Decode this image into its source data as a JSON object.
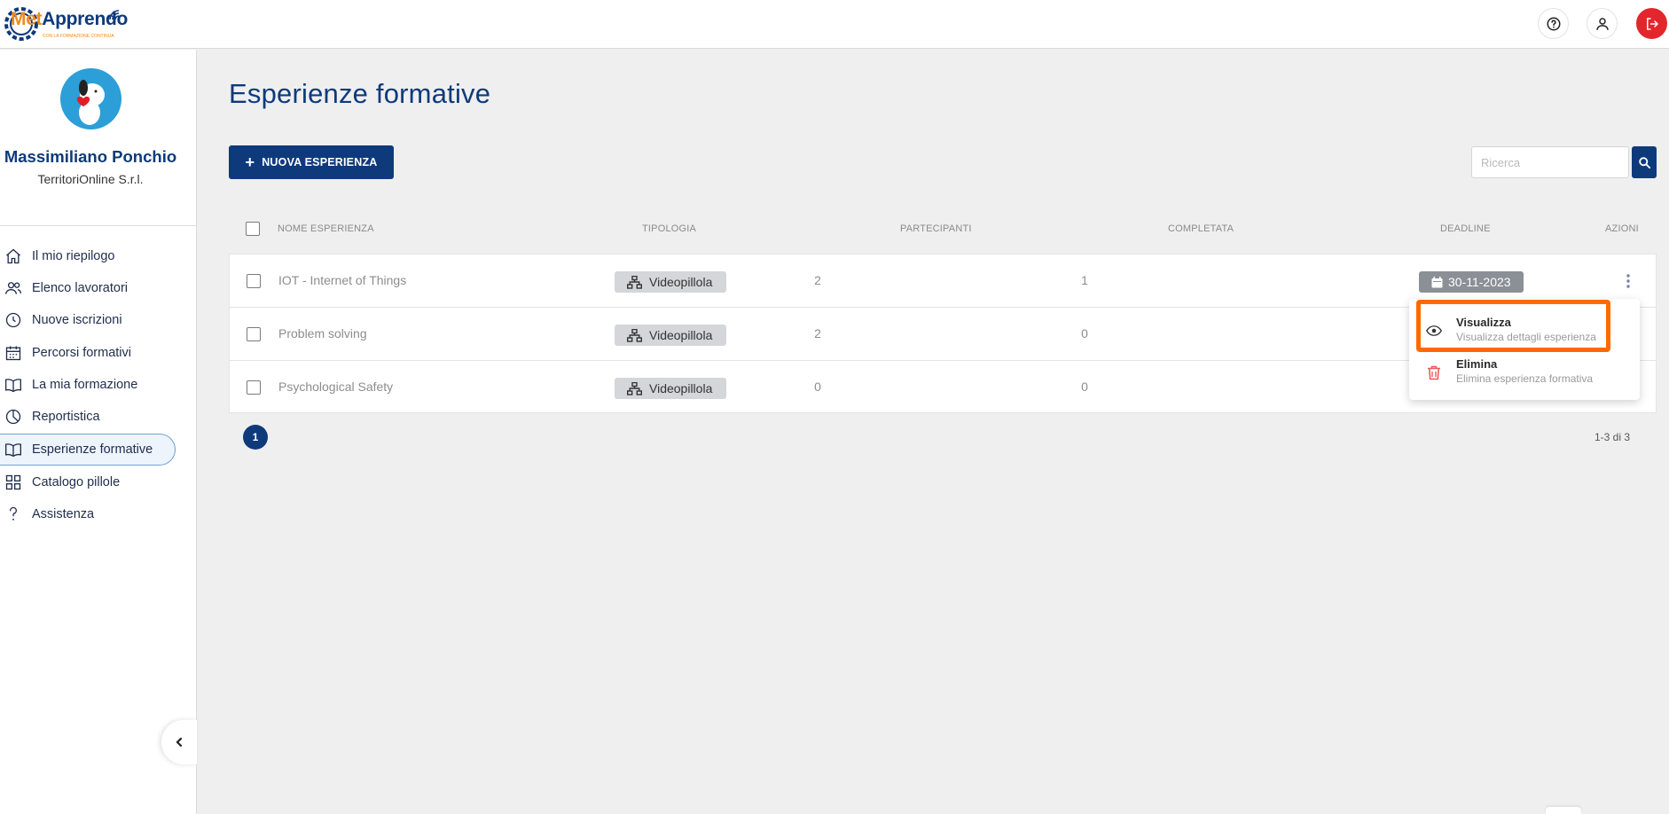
{
  "header": {
    "logo_prefix": "Met",
    "logo_main": "Apprendo",
    "logo_tagline": "CON LA FORMAZIONE CONTINUA",
    "help_icon": "help-circle-icon",
    "user_icon": "user-icon",
    "logout_icon": "logout-icon"
  },
  "sidebar": {
    "user_name": "Massimiliano Ponchio",
    "company": "TerritoriOnline S.r.l.",
    "items": [
      {
        "label": "Il mio riepilogo",
        "icon": "home-icon"
      },
      {
        "label": "Elenco lavoratori",
        "icon": "users-icon"
      },
      {
        "label": "Nuove iscrizioni",
        "icon": "clock-icon"
      },
      {
        "label": "Percorsi formativi",
        "icon": "calendar-icon"
      },
      {
        "label": "La mia formazione",
        "icon": "book-open-icon"
      },
      {
        "label": "Reportistica",
        "icon": "pie-chart-icon"
      },
      {
        "label": "Esperienze formative",
        "icon": "book-open-icon",
        "active": true
      },
      {
        "label": "Catalogo pillole",
        "icon": "grid-icon"
      },
      {
        "label": "Assistenza",
        "icon": "question-icon"
      }
    ]
  },
  "main": {
    "title": "Esperienze formative",
    "new_button": "NUOVA ESPERIENZA",
    "search_placeholder": "Ricerca",
    "columns": [
      "NOME ESPERIENZA",
      "TIPOLOGIA",
      "PARTECIPANTI",
      "COMPLETATA",
      "DEADLINE",
      "AZIONI"
    ],
    "rows": [
      {
        "name": "IOT - Internet of Things",
        "type": "Videopillola",
        "participants": "2",
        "completed": "1",
        "deadline": "30-11-2023"
      },
      {
        "name": "Problem solving",
        "type": "Videopillola",
        "participants": "2",
        "completed": "0",
        "deadline": ""
      },
      {
        "name": "Psychological Safety",
        "type": "Videopillola",
        "participants": "0",
        "completed": "0",
        "deadline": ""
      }
    ],
    "menu": [
      {
        "title": "Visualizza",
        "subtitle": "Visualizza dettagli esperienza",
        "icon": "eye-icon"
      },
      {
        "title": "Elimina",
        "subtitle": "Elimina esperienza formativa",
        "icon": "trash-icon"
      }
    ],
    "page": "1",
    "page_info": "1-3 di 3"
  },
  "colors": {
    "primary": "#0e3a7c",
    "logout": "#e3262b",
    "highlight": "#ff6a00",
    "danger": "#e85a5a"
  }
}
